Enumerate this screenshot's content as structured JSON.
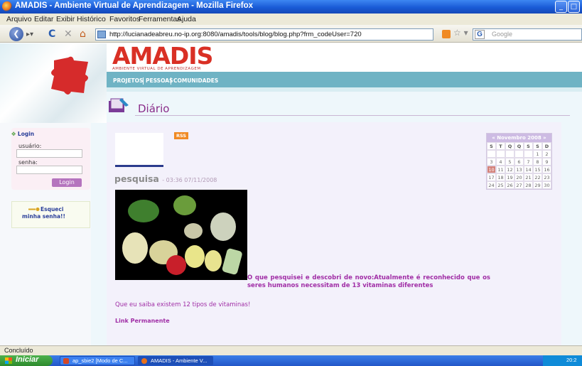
{
  "window": {
    "title": "AMADIS - Ambiente Virtual de Aprendizagem - Mozilla Firefox"
  },
  "menu": [
    "Arquivo",
    "Editar",
    "Exibir",
    "Histórico",
    "Favoritos",
    "Ferramentas",
    "Ajuda"
  ],
  "address": {
    "url": "http://lucianadeabreu.no-ip.org:8080/amadis/tools/blog/blog.php?frm_codeUser=720"
  },
  "search": {
    "placeholder": "Google"
  },
  "site": {
    "logo": "AMADIS",
    "subtitle": "AMBIENTE VIRTUAL DE APRENDIZAGEM",
    "tabs": [
      "PROJETOS",
      "PESSOAS",
      "COMUNIDADES"
    ]
  },
  "page": {
    "title": "Diário"
  },
  "login": {
    "title": "Login",
    "user_label": "usuário:",
    "pass_label": "senha:",
    "button": "Login",
    "forgot": "Esqueci minha senha!!"
  },
  "blog": {
    "rss": "RSS",
    "post_title": "pesquisa",
    "post_date": "- 03:36 07/11/2008",
    "paragraph1": "O que pesquisei e descobri de novo:Atualmente é reconhecido que os seres humanos necessitam de 13 vitaminas diferentes",
    "paragraph2": "Que eu saiba existem 12 tipos de vitaminas!",
    "permalink": "Link Permanente"
  },
  "calendar": {
    "month": "Novembro 2008",
    "prev": "«",
    "next": "»",
    "weekdays": [
      "S",
      "T",
      "Q",
      "Q",
      "S",
      "S",
      "D"
    ],
    "days": [
      "",
      "",
      "",
      "",
      "",
      "1",
      "2",
      "3",
      "4",
      "5",
      "6",
      "7",
      "8",
      "9",
      "10",
      "11",
      "12",
      "13",
      "14",
      "15",
      "16",
      "17",
      "18",
      "19",
      "20",
      "21",
      "22",
      "23",
      "24",
      "25",
      "26",
      "27",
      "28",
      "29",
      "30"
    ],
    "highlight": "10"
  },
  "status": {
    "text": "Concluído"
  },
  "taskbar": {
    "start": "Iniciar",
    "tasks": [
      "ap_sbie2 [Modo de C...",
      "AMADIS - Ambiente V..."
    ],
    "clock": "20:2"
  }
}
